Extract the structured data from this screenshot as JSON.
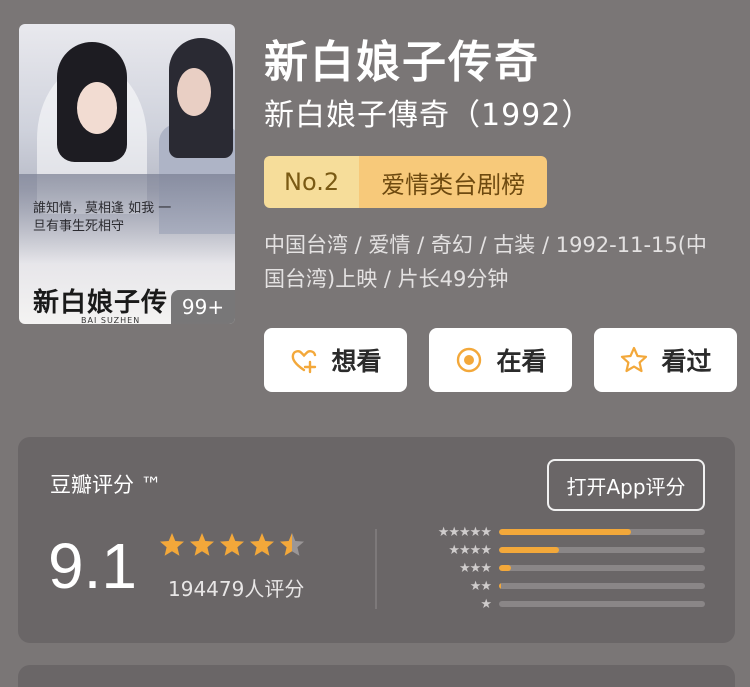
{
  "poster": {
    "calligraphy": "誰知情，莫相逢 如我 一旦有事生死相守",
    "title_art": "新白娘子传奇",
    "title_sub": "BAI SUZHEN",
    "photo_badge": "99+"
  },
  "title": "新白娘子传奇",
  "subtitle": "新白娘子傳奇（1992）",
  "rank": {
    "no": "No.2",
    "list": "爱情类台剧榜"
  },
  "meta": "中国台湾 / 爱情 / 奇幻 / 古装 / 1992-11-15(中国台湾)上映 / 片长49分钟",
  "actions": [
    {
      "label": "想看",
      "icon": "heart-plus-icon"
    },
    {
      "label": "在看",
      "icon": "target-icon"
    },
    {
      "label": "看过",
      "icon": "star-outline-icon"
    }
  ],
  "rating": {
    "source_label": "豆瓣评分 ™",
    "open_app_label": "打开App评分",
    "score": "9.1",
    "stars": 4.5,
    "count_label": "194479人评分",
    "distribution": [
      {
        "stars": 5,
        "fraction": 0.64
      },
      {
        "stars": 4,
        "fraction": 0.29
      },
      {
        "stars": 3,
        "fraction": 0.06
      },
      {
        "stars": 2,
        "fraction": 0.01
      },
      {
        "stars": 1,
        "fraction": 0.0
      }
    ]
  },
  "colors": {
    "accent": "#f3a83a",
    "background": "#7a7676",
    "card": "#6a6667"
  }
}
